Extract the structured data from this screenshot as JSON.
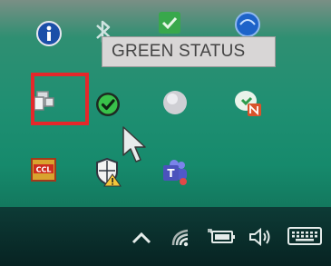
{
  "tooltip": {
    "text": "GREEN STATUS"
  },
  "tray_icons": [
    {
      "name": "info-icon"
    },
    {
      "name": "bluetooth-icon"
    },
    {
      "name": "green-check-app-icon"
    },
    {
      "name": "blue-globe-app-icon"
    },
    {
      "name": "remote-desktop-icon"
    },
    {
      "name": "green-status-icon"
    },
    {
      "name": "gray-circle-icon"
    },
    {
      "name": "notes-n-icon"
    },
    {
      "name": "ccl-app-icon"
    },
    {
      "name": "windows-security-warning-icon"
    },
    {
      "name": "teams-icon"
    }
  ],
  "highlight": {
    "color": "#e5272a",
    "target": "remote-desktop-icon"
  },
  "taskbar": {
    "icons": [
      "chevron-up-icon",
      "wifi-icon",
      "battery-icon",
      "volume-icon",
      "keyboard-icon"
    ]
  }
}
